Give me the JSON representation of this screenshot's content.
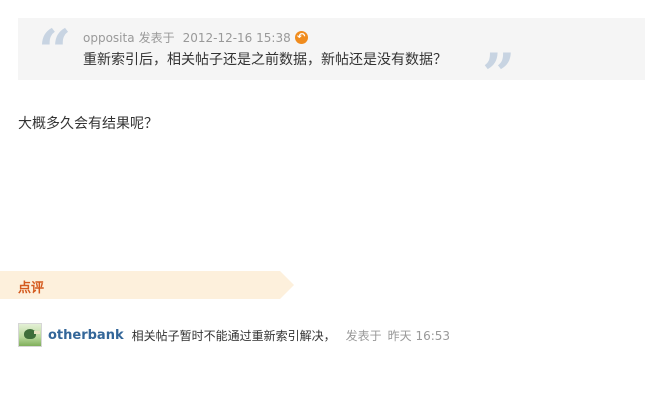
{
  "quote": {
    "author": "opposita",
    "posted_label": "发表于",
    "time": "2012-12-16 15:38",
    "text": "重新索引后，相关帖子还是之前数据，新帖还是没有数据？",
    "open_mark": "“",
    "close_mark": "”"
  },
  "post": {
    "body": "大概多久会有结果呢？"
  },
  "comments": {
    "title": "点评",
    "items": [
      {
        "user": "otherbank",
        "text": "相关帖子暂时不能通过重新索引解决，",
        "posted_label": "发表于",
        "time": "昨天 16:53"
      }
    ]
  },
  "colors": {
    "quote_bg": "#f5f5f5",
    "quote_mark": "#c8d4e2",
    "comment_header_bg": "#fdf0dc",
    "comment_title": "#d45a1e",
    "username": "#336699",
    "meta": "#999999",
    "reply_icon": "#f08c1e"
  },
  "icons": {
    "reply": "reply-arrow-icon",
    "avatar": "user-avatar"
  }
}
